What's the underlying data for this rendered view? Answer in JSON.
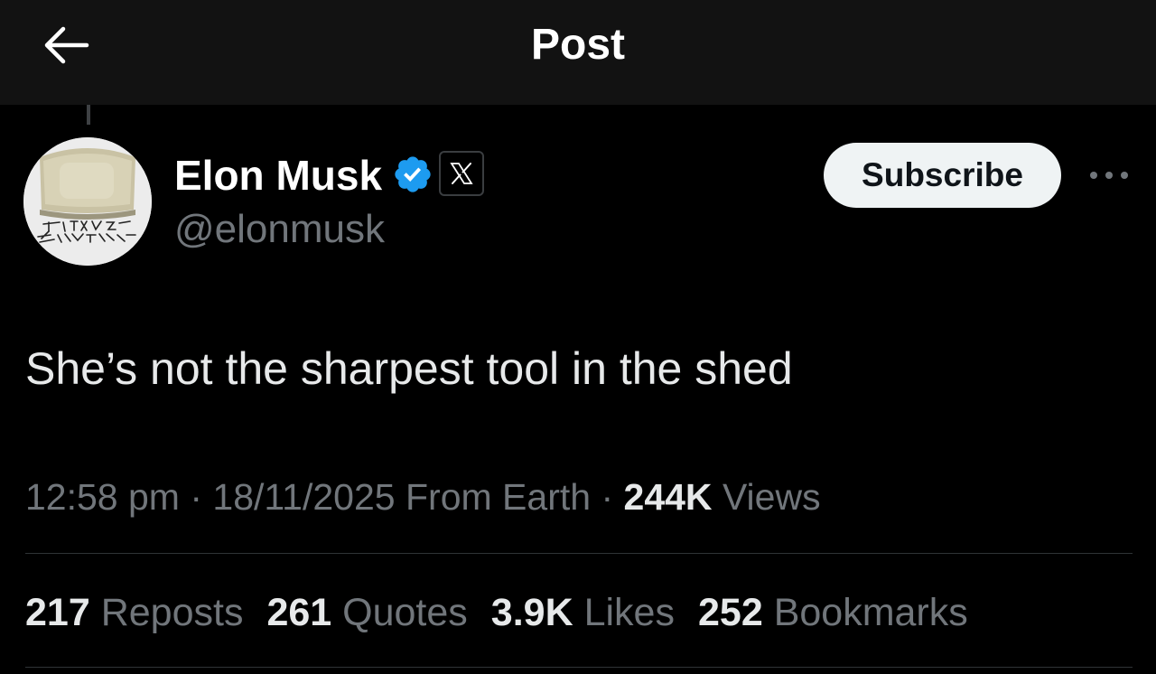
{
  "header": {
    "title": "Post",
    "back_icon": "arrow-left-icon"
  },
  "author": {
    "display_name": "Elon Musk",
    "handle": "@elonmusk",
    "verified_icon": "verified-badge-icon",
    "verified_color": "#1d9bf0",
    "affiliate_icon": "x-logo-icon",
    "avatar_lettering": [
      "THE FUTURE",
      "IS AWESOME"
    ]
  },
  "actions": {
    "subscribe_label": "Subscribe",
    "more_icon": "more-horizontal-icon"
  },
  "post": {
    "text": "She’s not the sharpest tool in the shed",
    "time": "12:58 pm",
    "date": "18/11/2025",
    "location": "From Earth",
    "views_count": "244K",
    "views_label": "Views",
    "separator": "·"
  },
  "stats": [
    {
      "count": "217",
      "label": "Reposts"
    },
    {
      "count": "261",
      "label": "Quotes"
    },
    {
      "count": "3.9K",
      "label": "Likes"
    },
    {
      "count": "252",
      "label": "Bookmarks"
    }
  ],
  "colors": {
    "background": "#000000",
    "header_background": "#121212",
    "primary_text": "#e7e9ea",
    "secondary_text": "#71767b",
    "divider": "#2f3336",
    "button_background": "#eff3f4"
  }
}
